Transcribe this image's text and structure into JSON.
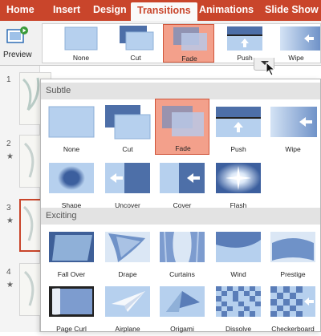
{
  "ribbon_tabs": [
    "Home",
    "Insert",
    "Design",
    "Transitions",
    "Animations",
    "Slide Show"
  ],
  "active_tab": "Transitions",
  "preview": {
    "label": "Preview"
  },
  "ribbon_gallery": [
    {
      "label": "None",
      "icon": "none-transition-icon"
    },
    {
      "label": "Cut",
      "icon": "cut-transition-icon"
    },
    {
      "label": "Fade",
      "icon": "fade-transition-icon",
      "selected": true
    },
    {
      "label": "Push",
      "icon": "push-transition-icon"
    },
    {
      "label": "Wipe",
      "icon": "wipe-transition-icon"
    }
  ],
  "slides": [
    {
      "number": "1",
      "star": ""
    },
    {
      "number": "2",
      "star": "★"
    },
    {
      "number": "3",
      "star": "★",
      "selected": true
    },
    {
      "number": "4",
      "star": "★"
    }
  ],
  "gallery": {
    "subtle_header": "Subtle",
    "exciting_header": "Exciting",
    "subtle": [
      {
        "label": "None"
      },
      {
        "label": "Cut"
      },
      {
        "label": "Fade",
        "selected": true
      },
      {
        "label": "Push"
      },
      {
        "label": "Wipe"
      },
      {
        "label": "Shape"
      },
      {
        "label": "Uncover"
      },
      {
        "label": "Cover"
      },
      {
        "label": "Flash"
      }
    ],
    "exciting": [
      {
        "label": "Fall Over"
      },
      {
        "label": "Drape"
      },
      {
        "label": "Curtains"
      },
      {
        "label": "Wind"
      },
      {
        "label": "Prestige"
      },
      {
        "label": "Page Curl"
      },
      {
        "label": "Airplane"
      },
      {
        "label": "Origami"
      },
      {
        "label": "Dissolve"
      },
      {
        "label": "Checkerboard"
      }
    ]
  },
  "colors": {
    "accent": "#c9452b",
    "selected_bg": "#f3a08b",
    "thumb_blue": "#6f92c8"
  }
}
